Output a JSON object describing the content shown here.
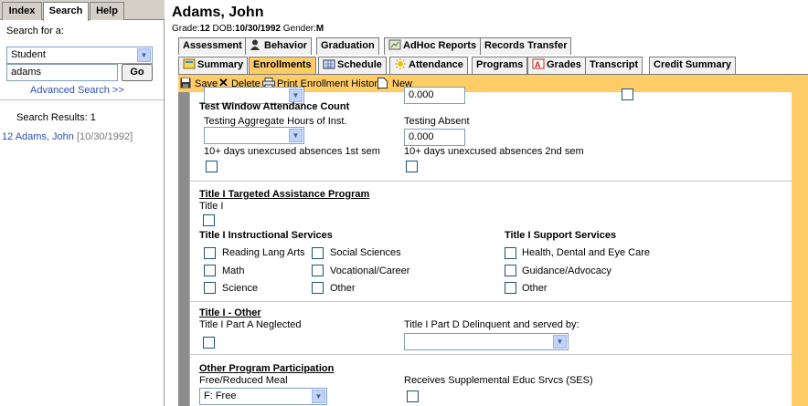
{
  "left_tabs": [
    "Index",
    "Search",
    "Help"
  ],
  "search": {
    "label": "Search for a:",
    "type_value": "Student",
    "query": "adams",
    "go": "Go",
    "advanced": "Advanced Search >>",
    "results_label": "Search Results: 1",
    "result_grade": "12",
    "result_name": "Adams, John",
    "result_dob": "[10/30/1992]"
  },
  "student": {
    "name": "Adams, John",
    "grade_label": "Grade:",
    "grade": "12",
    "dob_label": "DOB:",
    "dob": "10/30/1992",
    "gender_label": "Gender:",
    "gender": "M"
  },
  "tabs_row1": [
    "Assessment",
    "Behavior",
    "Graduation",
    "AdHoc Reports",
    "Records Transfer"
  ],
  "tabs_row2": [
    "Summary",
    "Enrollments",
    "Schedule",
    "Attendance",
    "Programs",
    "Grades",
    "Transcript",
    "Credit Summary"
  ],
  "toolbar": {
    "save": "Save",
    "delete": "Delete",
    "print": "Print Enrollment History",
    "new": "New"
  },
  "form": {
    "top_value": "0.000",
    "twac_heading": "Test Window Attendance Count",
    "testing_agg_label": "Testing Aggregate Hours of Inst.",
    "testing_absent_label": "Testing Absent",
    "testing_absent_value": "0.000",
    "unexcused1": "10+ days unexcused absences 1st sem",
    "unexcused2": "10+ days unexcused absences 2nd sem",
    "title1_tap": "Title I Targeted Assistance Program",
    "title1_label": "Title I",
    "instr_heading": "Title I Instructional Services",
    "support_heading": "Title I Support Services",
    "instr": [
      "Reading Lang Arts",
      "Social Sciences",
      "Math",
      "Vocational/Career",
      "Science",
      "Other"
    ],
    "support": [
      "Health, Dental and Eye Care",
      "Guidance/Advocacy",
      "Other"
    ],
    "title1_other": "Title I - Other",
    "part_a": "Title I Part A Neglected",
    "part_d": "Title I Part D Delinquent and served by:",
    "other_prog": "Other Program Participation",
    "free_reduced": "Free/Reduced Meal",
    "free_value": "F: Free",
    "ses_label": "Receives Supplemental Educ Srvcs (SES)"
  }
}
